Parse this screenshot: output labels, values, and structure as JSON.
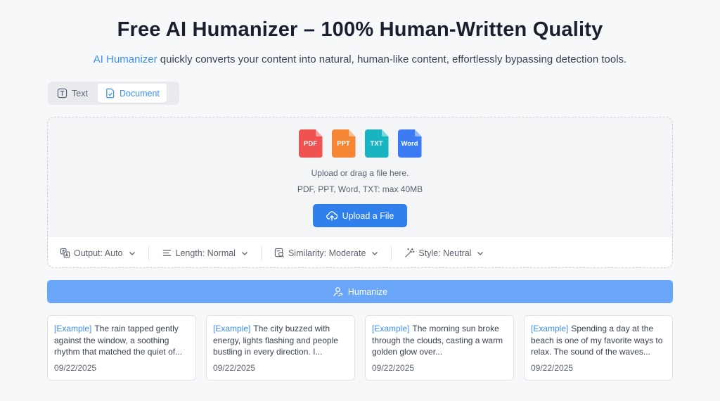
{
  "header": {
    "title": "Free AI Humanizer – 100% Human-Written Quality",
    "subtitle_link": "AI Humanizer",
    "subtitle_rest": " quickly converts your content into natural, human-like content, effortlessly bypassing detection tools."
  },
  "tabs": [
    {
      "label": "Text",
      "active": false
    },
    {
      "label": "Document",
      "active": true
    }
  ],
  "upload": {
    "file_types": [
      {
        "label": "PDF",
        "color": "#f05252"
      },
      {
        "label": "PPT",
        "color": "#f58634"
      },
      {
        "label": "TXT",
        "color": "#19b4c2"
      },
      {
        "label": "Word",
        "color": "#3b7cf5"
      }
    ],
    "hint": "Upload or drag a file here.",
    "formats": "PDF, PPT, Word, TXT: max 40MB",
    "button_label": "Upload a File"
  },
  "options": [
    {
      "label": "Output: Auto",
      "icon": "translate-icon"
    },
    {
      "label": "Length: Normal",
      "icon": "lines-icon"
    },
    {
      "label": "Similarity: Moderate",
      "icon": "similarity-icon"
    },
    {
      "label": "Style: Neutral",
      "icon": "magic-wand-icon"
    }
  ],
  "humanize_label": "Humanize",
  "examples": [
    {
      "tag": "[Example]",
      "text": "The rain tapped gently against the window, a soothing rhythm that matched the quiet of...",
      "date": "09/22/2025"
    },
    {
      "tag": "[Example]",
      "text": "The city buzzed with energy, lights flashing and people bustling in every direction. I...",
      "date": "09/22/2025"
    },
    {
      "tag": "[Example]",
      "text": "The morning sun broke through the clouds, casting a warm golden glow over...",
      "date": "09/22/2025"
    },
    {
      "tag": "[Example]",
      "text": "Spending a day at the beach is one of my favorite ways to relax. The sound of the waves...",
      "date": "09/22/2025"
    }
  ],
  "colors": {
    "accent": "#2f80ed",
    "link": "#3a8ef0",
    "humanize_button": "#6aa6f7"
  }
}
